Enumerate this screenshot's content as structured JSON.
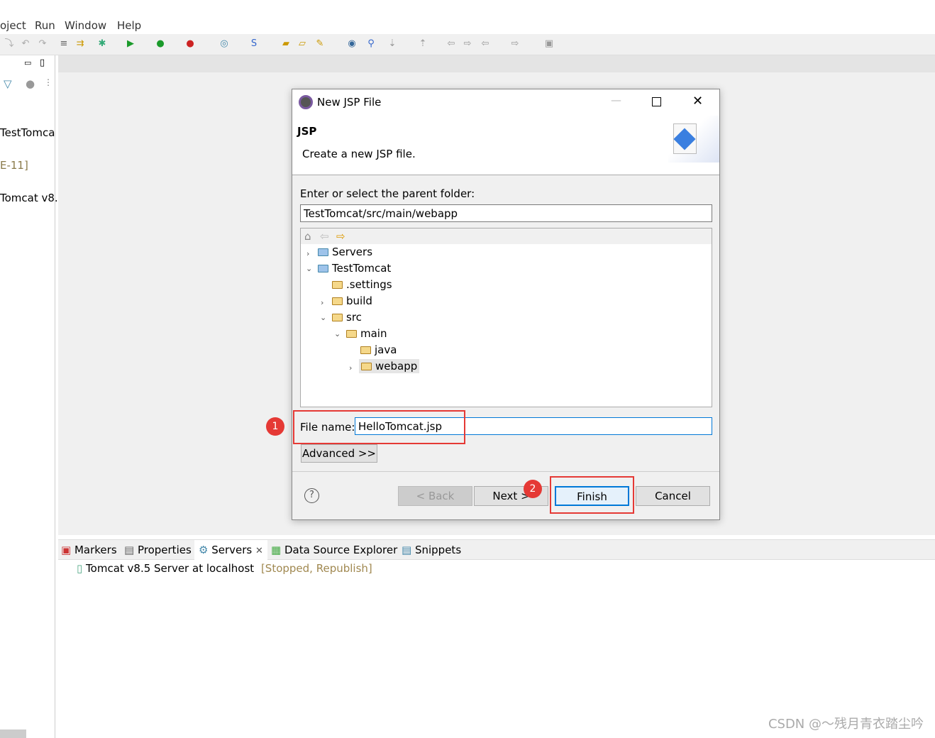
{
  "menu": {
    "items": [
      "oject",
      "Run",
      "Window",
      "Help"
    ]
  },
  "toolbar": {
    "icons": [
      "step-icon",
      "undo-icon",
      "redo-icon",
      "format-icon",
      "debug-icon",
      "run-icon",
      "run-server-icon",
      "stop-server-icon",
      "new-server-icon",
      "new-service-icon",
      "open-folder-icon",
      "folder-icon",
      "pen-icon",
      "globe-icon",
      "search-icon",
      "next-annotation-icon",
      "prev-annotation-icon",
      "back-icon",
      "forward-icon",
      "pin-icon"
    ]
  },
  "left_panel": {
    "items": [
      "TestTomca",
      "E-11]",
      "Tomcat v8."
    ]
  },
  "dialog": {
    "title": "New JSP File",
    "heading": "JSP",
    "description": "Create a new JSP file.",
    "folder_label": "Enter or select the parent folder:",
    "folder_value": "TestTomcat/src/main/webapp",
    "tree": [
      {
        "label": "Servers",
        "level": 0,
        "expander": "collapsed"
      },
      {
        "label": "TestTomcat",
        "level": 0,
        "expander": "expanded"
      },
      {
        "label": ".settings",
        "level": 1,
        "expander": "none"
      },
      {
        "label": "build",
        "level": 1,
        "expander": "collapsed"
      },
      {
        "label": "src",
        "level": 1,
        "expander": "expanded"
      },
      {
        "label": "main",
        "level": 2,
        "expander": "expanded"
      },
      {
        "label": "java",
        "level": 3,
        "expander": "none"
      },
      {
        "label": "webapp",
        "level": 3,
        "expander": "collapsed",
        "selected": true
      }
    ],
    "file_name_label": "File name:",
    "file_name_value": "HelloTomcat.jsp",
    "advanced_label": "Advanced >>",
    "back_label": "< Back",
    "next_label": "Next >",
    "finish_label": "Finish",
    "cancel_label": "Cancel"
  },
  "annotations": {
    "step1": "1",
    "step2": "2",
    "color": "#e53935"
  },
  "bottom": {
    "tabs": [
      "Markers",
      "Properties",
      "Servers",
      "Data Source Explorer",
      "Snippets"
    ],
    "server_name": "Tomcat v8.5 Server at localhost",
    "server_status": "[Stopped, Republish]"
  },
  "watermark": "CSDN @～残月青衣踏尘吟"
}
